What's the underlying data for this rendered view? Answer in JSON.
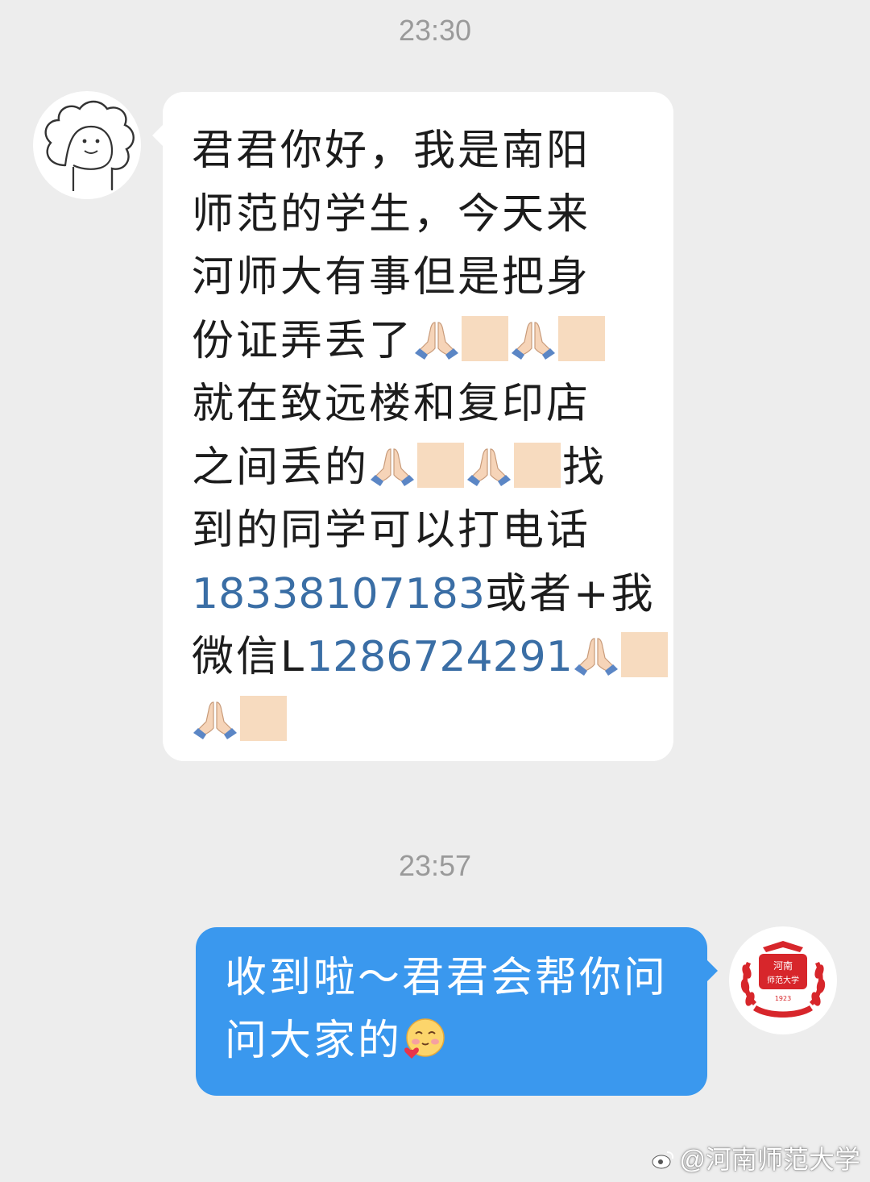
{
  "colors": {
    "background": "#ededed",
    "incoming_bubble": "#ffffff",
    "outgoing_bubble": "#3a98ee",
    "link": "#3a6ea5",
    "redacted_block": "#f7dbbf",
    "seal_red": "#d7262b"
  },
  "conversation": {
    "timestamp_1": "23:30",
    "incoming_message": {
      "lines": [
        "君君你好，我是南阳",
        "师范的学生，今天来",
        "河师大有事但是把身",
        "份证弄丢了",
        "就在致远楼和复印店",
        "之间丢的",
        "找",
        "到的同学可以打电话",
        "18338107183",
        "或者+我",
        "微信L",
        "1286724291"
      ],
      "emoji": "praying-hands"
    },
    "timestamp_2": "23:57",
    "outgoing_message": {
      "lines": [
        "收到啦～君君会帮你问",
        "问大家的"
      ],
      "emoji": "blushing-face-with-heart"
    }
  },
  "outgoing_avatar": {
    "seal_text_top": "河南",
    "seal_text_middle": "师范大学",
    "seal_year": "1923"
  },
  "watermark": {
    "text": "@河南师范大学"
  }
}
